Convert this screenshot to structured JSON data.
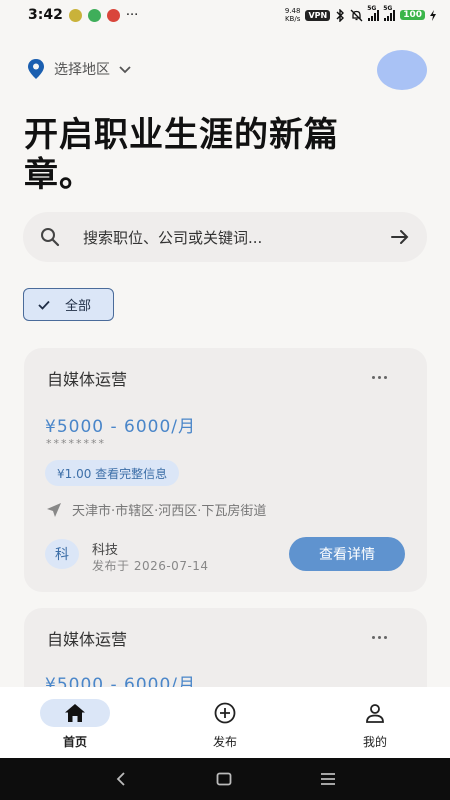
{
  "status_bar": {
    "time": "3:42",
    "more": "···",
    "net_speed_value": "9.48",
    "net_speed_unit": "KB/s",
    "vpn": "VPN",
    "signal_1": "5G",
    "signal_2": "5G",
    "battery": "100"
  },
  "header": {
    "location_label": "选择地区",
    "title": "开启职业生涯的新篇章。"
  },
  "search": {
    "placeholder": "搜索职位、公司或关键词..."
  },
  "filter": {
    "chip_label": "全部"
  },
  "jobs": [
    {
      "title": "自媒体运营",
      "salary": "¥5000 - 6000/月",
      "masked": "********",
      "unlock_label": "¥1.00 查看完整信息",
      "address": "天津市·市辖区·河西区·下瓦房街道",
      "company_initial": "科",
      "company": "科技",
      "published": "发布于 2026-07-14",
      "detail_button": "查看详情"
    },
    {
      "title": "自媒体运营",
      "salary": "¥5000 - 6000/月"
    }
  ],
  "bottom_nav": {
    "home": "首页",
    "publish": "发布",
    "mine": "我的"
  },
  "colors": {
    "accent": "#5f93cf",
    "accent_light": "#dbe6f7",
    "salary": "#4a86c9",
    "avatar": "#a9c2f5"
  }
}
